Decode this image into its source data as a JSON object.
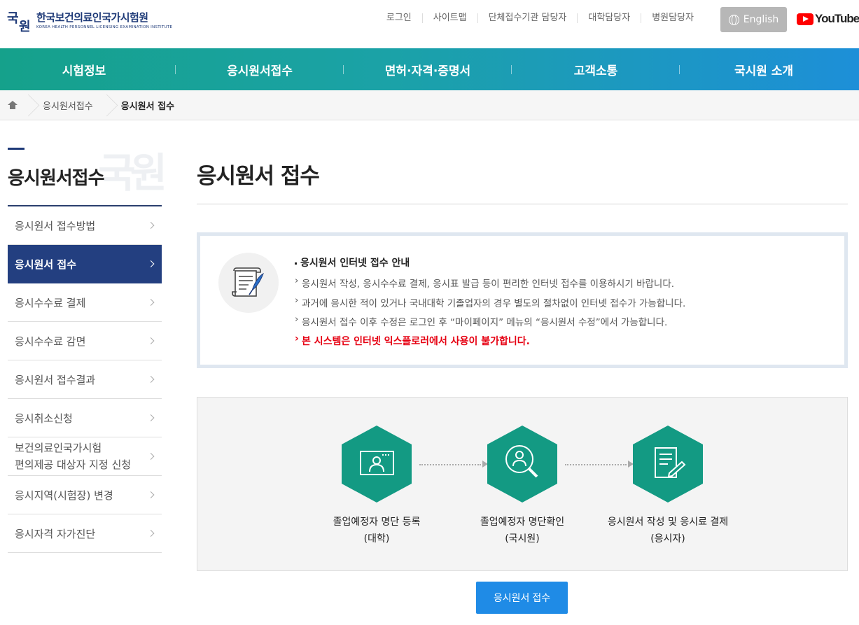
{
  "header": {
    "logo_mark_top": "국",
    "logo_mark_bottom": "원",
    "logo_kr": "한국보건의료인국가시험원",
    "logo_en": "KOREA HEALTH PERSONNEL LICENSING EXAMINATION INSTITUTE",
    "util_links": [
      "로그인",
      "사이트맵",
      "단체접수기관 담당자",
      "대학담당자",
      "병원담당자"
    ],
    "english_label": "English",
    "youtube_label": "YouTube"
  },
  "gnb": [
    "시험정보",
    "응시원서접수",
    "면허·자격·증명서",
    "고객소통",
    "국시원 소개"
  ],
  "breadcrumb": [
    "응시원서접수",
    "응시원서 접수"
  ],
  "lnb": {
    "title": "응시원서접수",
    "watermark": "국원",
    "items": [
      "응시원서 접수방법",
      "응시원서 접수",
      "응시수수료 결제",
      "응시수수료 감면",
      "응시원서 접수결과",
      "응시취소신청",
      "보건의료인국가시험",
      "편의제공 대상자 지정 신청",
      "응시지역(시험장) 변경",
      "응시자격 자가진단"
    ]
  },
  "main": {
    "title": "응시원서 접수",
    "notice": {
      "heading": "응시원서 인터넷 접수 안내",
      "lines": [
        "응시원서 작성, 응시수수료 결제, 응시표 발급 등이 편리한 인터넷 접수를 이용하시기 바랍니다.",
        "과거에 응시한 적이 있거나 국내대학 기졸업자의 경우 별도의 절차없이 인터넷 접수가 가능합니다.",
        "응시원서 접수 이후 수정은 로그인 후 “마이페이지” 메뉴의 “응시원서 수정”에서 가능합니다."
      ],
      "warning": "본 시스템은 인터넷 익스플로러에서 사용이 불가합니다."
    },
    "steps": [
      {
        "line1": "졸업예정자 명단 등록",
        "line2": "(대학)",
        "icon": "monitor-person-icon"
      },
      {
        "line1": "졸업예정자 명단확인",
        "line2": "(국시원)",
        "icon": "magnifier-person-icon"
      },
      {
        "line1": "응시원서 작성 및 응시료 결제",
        "line2": "(응시자)",
        "icon": "document-pen-icon"
      }
    ],
    "apply_button": "응시원서 접수"
  },
  "colors": {
    "navy": "#1e3a78",
    "active_menu": "#233f80",
    "teal": "#139a83",
    "blue_button": "#1f8be6",
    "warning_red": "#e60012"
  }
}
